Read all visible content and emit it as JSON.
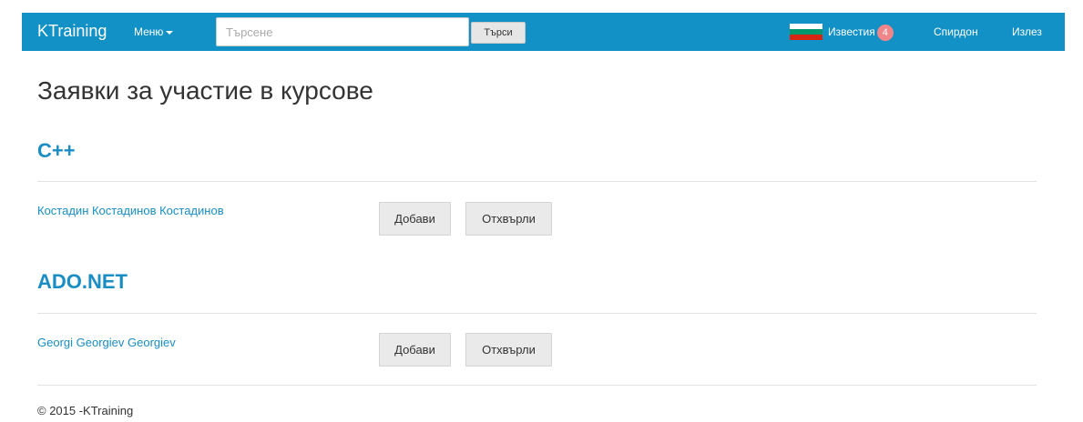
{
  "navbar": {
    "brand": "KTraining",
    "menu_label": "Меню",
    "search_placeholder": "Търсене",
    "search_button": "Търси",
    "notifications_label": "Известия",
    "notifications_count": "4",
    "user_name": "Спирдон",
    "logout_label": "Излез"
  },
  "page": {
    "title": "Заявки за участие в курсове"
  },
  "courses": [
    {
      "name": "C++",
      "requests": [
        {
          "person": "Костадин Костадинов Костадинов",
          "accept_label": "Добави",
          "reject_label": "Отхвърли"
        }
      ]
    },
    {
      "name": "ADO.NET",
      "requests": [
        {
          "person": "Georgi Georgiev Georgiev",
          "accept_label": "Добави",
          "reject_label": "Отхвърли"
        }
      ]
    }
  ],
  "footer": {
    "text": "© 2015 -KTraining"
  },
  "colors": {
    "navbar": "#1291c7",
    "link": "#1a8dc4",
    "badge": "#f0868a",
    "button": "#eaeaea"
  }
}
